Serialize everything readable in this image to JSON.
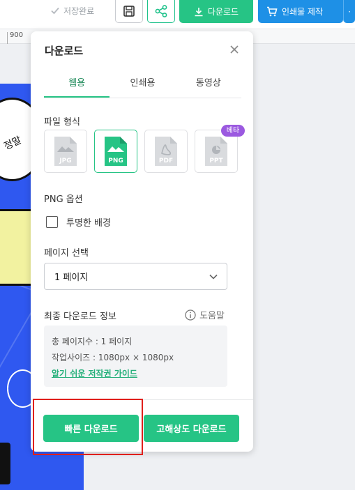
{
  "toolbar": {
    "saved_label": "저장완료",
    "download_label": "다운로드",
    "print_label": "인쇄물 제작",
    "more_label": "·",
    "brand_green": "#26c485",
    "brand_blue": "#1e90e6"
  },
  "ruler": {
    "label": "900"
  },
  "artwork": {
    "bubble_text": "정말"
  },
  "panel": {
    "title": "다운로드",
    "tabs": [
      {
        "label": "웹용",
        "active": true
      },
      {
        "label": "인쇄용",
        "active": false
      },
      {
        "label": "동영상",
        "active": false
      }
    ],
    "file_format": {
      "label": "파일 형식",
      "options": [
        {
          "label": "JPG",
          "icon": "jpg-file-icon",
          "selected": false
        },
        {
          "label": "PNG",
          "icon": "png-file-icon",
          "selected": true
        },
        {
          "label": "PDF",
          "icon": "pdf-file-icon",
          "selected": false
        },
        {
          "label": "PPT",
          "icon": "ppt-file-icon",
          "selected": false
        }
      ],
      "beta_badge": "베타"
    },
    "png_options": {
      "label": "PNG 옵션",
      "transparent_bg_label": "투명한 배경",
      "transparent_bg_checked": false
    },
    "page_select": {
      "label": "페이지 선택",
      "value": "1 페이지"
    },
    "final_info": {
      "label": "최종 다운로드 정보",
      "help_label": "도움말",
      "total_pages": "총 페이지수 : 1 페이지",
      "work_size": "작업사이즈 : 1080px × 1080px",
      "copyright_link": "알기 쉬운 저작권 가이드"
    },
    "fast_download_label": "빠른 다운로드",
    "hq_download_label": "고해상도 다운로드"
  }
}
